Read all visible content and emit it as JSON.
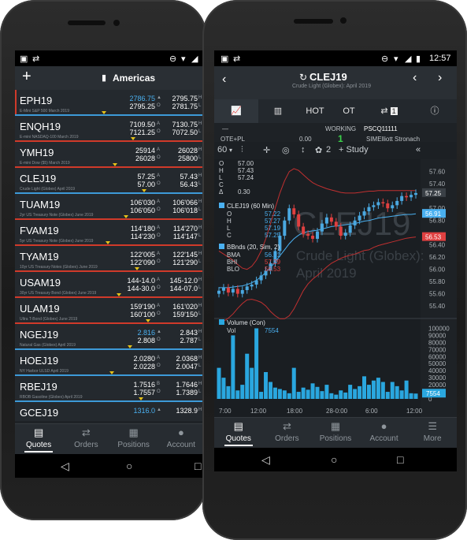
{
  "left": {
    "status_icons": [
      "image-icon",
      "sync-icon",
      "dnd-icon",
      "wifi-icon",
      "signal-icon",
      "battery-icon"
    ],
    "header": {
      "title": "Americas",
      "add": "+"
    },
    "quotes": [
      {
        "symbol": "EPH19",
        "desc": "E-Mini S&P 500 March 2019",
        "bid": "2786.75",
        "ask": "2795.25",
        "bid_dir": "▲",
        "ask_dir": "O",
        "high": "2795.75",
        "low": "2781.75",
        "h": "H",
        "l": "L",
        "bid_color": "#4ab0f0",
        "bar": "blue",
        "flag": true
      },
      {
        "symbol": "ENQH19",
        "desc": "E-mini NASDAQ-100 March 2019",
        "bid": "7109.50",
        "ask": "7121.25",
        "bid_dir": "A",
        "ask_dir": "O",
        "high": "7130.75",
        "low": "7072.50",
        "h": "H",
        "l": "L",
        "bid_color": "#ffffff",
        "bar": "red",
        "flag": false
      },
      {
        "symbol": "YMH19",
        "desc": "E-mini Dow ($5) March 2019",
        "bid": "25914",
        "ask": "26028",
        "bid_dir": "A",
        "ask_dir": "O",
        "high": "26028",
        "low": "25800",
        "h": "H",
        "l": "L",
        "bid_color": "#ffffff",
        "bar": "red",
        "flag": false
      },
      {
        "symbol": "CLEJ19",
        "desc": "Crude Light (Globex) April 2019",
        "bid": "57.25",
        "ask": "57.00",
        "bid_dir": "A",
        "ask_dir": "O",
        "high": "57.43",
        "low": "56.43",
        "h": "H",
        "l": "L",
        "bid_color": "#ffffff",
        "bar": "blue",
        "flag": false
      },
      {
        "symbol": "TUAM19",
        "desc": "2yr US Treasury Note (Globex) June 2019",
        "bid": "106'030",
        "ask": "106'050",
        "bid_dir": "A",
        "ask_dir": "O",
        "high": "106'066",
        "low": "106'018",
        "h": "H",
        "l": "L",
        "bid_color": "#ffffff",
        "bar": "red",
        "flag": false
      },
      {
        "symbol": "FVAM19",
        "desc": "5yr US Treasury Note (Globex) June 2019",
        "bid": "114'180",
        "ask": "114'230",
        "bid_dir": "A",
        "ask_dir": "O",
        "high": "114'270",
        "low": "114'147",
        "h": "H",
        "l": "L",
        "bid_color": "#ffffff",
        "bar": "red",
        "flag": false
      },
      {
        "symbol": "TYAM19",
        "desc": "10yr US Treasury Notes (Globex) June 2019",
        "bid": "122'005",
        "ask": "122'090",
        "bid_dir": "A",
        "ask_dir": "O",
        "high": "122'145",
        "low": "121'290",
        "h": "H",
        "l": "L",
        "bid_color": "#ffffff",
        "bar": "red",
        "flag": false
      },
      {
        "symbol": "USAM19",
        "desc": "30yr US Treasury Bond (Globex) June 2019",
        "bid": "144-14.0",
        "ask": "144-30.0",
        "bid_dir": "A",
        "ask_dir": "O",
        "high": "145-12.0",
        "low": "144-07.0",
        "h": "H",
        "l": "L",
        "bid_color": "#ffffff",
        "bar": "red",
        "flag": false
      },
      {
        "symbol": "ULAM19",
        "desc": "Ultra T-Bond (Globex) June 2019",
        "bid": "159'190",
        "ask": "160'100",
        "bid_dir": "A",
        "ask_dir": "O",
        "high": "161'020",
        "low": "159'150",
        "h": "H",
        "l": "L",
        "bid_color": "#ffffff",
        "bar": "red",
        "flag": false
      },
      {
        "symbol": "NGEJ19",
        "desc": "Natural Gas (Globex) April 2019",
        "bid": "2.816",
        "ask": "2.808",
        "bid_dir": "▲",
        "ask_dir": "O",
        "high": "2.843",
        "low": "2.787",
        "h": "H",
        "l": "L",
        "bid_color": "#4ab0f0",
        "bar": "blue",
        "flag": false
      },
      {
        "symbol": "HOEJ19",
        "desc": "NY Harbor ULSD April 2019",
        "bid": "2.0280",
        "ask": "2.0228",
        "bid_dir": "A",
        "ask_dir": "O",
        "high": "2.0368",
        "low": "2.0047",
        "h": "H",
        "l": "L",
        "bid_color": "#ffffff",
        "bar": "blue",
        "flag": false
      },
      {
        "symbol": "RBEJ19",
        "desc": "RBOB Gasoline (Globex) April 2019",
        "bid": "1.7516",
        "ask": "1.7557",
        "bid_dir": "B",
        "ask_dir": "O",
        "high": "1.7646",
        "low": "1.7389",
        "h": "H",
        "l": "L",
        "bid_color": "#ffffff",
        "bar": "blue",
        "flag": false
      },
      {
        "symbol": "GCEJ19",
        "desc": "",
        "bid": "1316.0",
        "ask": "",
        "bid_dir": "▲",
        "ask_dir": "",
        "high": "1328.9",
        "low": "",
        "h": "H",
        "l": "",
        "bid_color": "#4ab0f0",
        "bar": "blue",
        "flag": false
      }
    ],
    "tabs": [
      {
        "label": "Quotes",
        "icon": "quotes-icon",
        "glyph": "▤"
      },
      {
        "label": "Orders",
        "icon": "orders-icon",
        "glyph": "⇄"
      },
      {
        "label": "Positions",
        "icon": "positions-icon",
        "glyph": "▦"
      },
      {
        "label": "Account",
        "icon": "account-icon",
        "glyph": "●"
      }
    ]
  },
  "right": {
    "status_time": "12:57",
    "header": {
      "symbol": "CLEJ19",
      "subtitle": "Crude Light (Globex): April 2019"
    },
    "toolbar": {
      "hot": "HOT",
      "ot": "OT",
      "orders_count": "1",
      "chart_icon": "chart-icon",
      "bars_icon": "bar-chart-icon",
      "info_icon": "info-icon"
    },
    "order_panel": {
      "minus": "—",
      "working_label": "WORKING",
      "working_value": "1",
      "account": "PSCQ11111",
      "ote_label": "OTE+PL",
      "ote_value": "0.00",
      "account_name": "SIMElliott Stronach"
    },
    "chart_toolbar": {
      "interval": "60",
      "drawing_count": "2",
      "study": "+ Study"
    },
    "chart_data": {
      "type": "line",
      "title": "CLEJ19 (60 Min)",
      "watermark_symbol": "CLEJ19",
      "watermark_name": "Crude Light (Globex):",
      "watermark_date": "April 2019",
      "cursor_ohlc": {
        "O": "57.00",
        "H": "57.43",
        "L": "57.24",
        "C": "0.30"
      },
      "cursor_labels": [
        "O",
        "H",
        "L",
        "C",
        "Δ"
      ],
      "cursor_values": [
        "57.00",
        "57.43",
        "57.24",
        "",
        "0.30"
      ],
      "bar_ohlc": {
        "O": "57.22",
        "H": "57.27",
        "L": "57.19",
        "C": "57.25"
      },
      "bbands_label": "BBnds (20, Sim, 2)",
      "bbands": {
        "BMA": "56.91",
        "BHI": "57.29",
        "BLO": "56.53"
      },
      "volume_label": "Volume (Con)",
      "vol_label": "Vol",
      "vol_value": "7554",
      "price_axis": [
        "57.60",
        "57.40",
        "57.25",
        "57.00",
        "56.91",
        "56.80",
        "56.53",
        "56.40",
        "56.20",
        "56.00",
        "55.80",
        "55.60",
        "55.40"
      ],
      "last_price": "57.25",
      "bma_tag": "56.91",
      "blo_tag": "56.53",
      "volume_axis": [
        "100000",
        "90000",
        "80000",
        "70000",
        "60000",
        "50000",
        "40000",
        "30000",
        "20000",
        "10000",
        "0"
      ],
      "volume_tag": "7554",
      "x_ticks": [
        "7:00",
        "12:00",
        "18:00",
        "28-0:00",
        "6:00",
        "12:00"
      ],
      "close": [
        55.65,
        55.7,
        55.62,
        55.68,
        55.6,
        55.66,
        55.72,
        55.75,
        55.82,
        55.9,
        55.98,
        56.1,
        56.3,
        56.55,
        56.8,
        57.0,
        56.9,
        56.7,
        56.58,
        56.55,
        56.5,
        56.62,
        56.75,
        56.85,
        56.78,
        56.7,
        56.55,
        56.6,
        56.72,
        56.8,
        56.88,
        56.95,
        57.02,
        57.05,
        57.1,
        57.08,
        57.0,
        57.05,
        57.12,
        57.2,
        57.18,
        57.22,
        57.25
      ],
      "bma": [
        55.7,
        55.7,
        55.7,
        55.71,
        55.72,
        55.73,
        55.75,
        55.78,
        55.82,
        55.88,
        55.95,
        56.03,
        56.12,
        56.22,
        56.32,
        56.42,
        56.5,
        56.56,
        56.6,
        56.62,
        56.63,
        56.64,
        56.66,
        56.68,
        56.7,
        56.71,
        56.72,
        56.73,
        56.74,
        56.75,
        56.77,
        56.79,
        56.8,
        56.82,
        56.84,
        56.85,
        56.86,
        56.87,
        56.88,
        56.89,
        56.9,
        56.9,
        56.91
      ],
      "bhi": [
        56.3,
        56.25,
        56.2,
        56.15,
        56.08,
        56.02,
        56.0,
        56.05,
        56.15,
        56.3,
        56.5,
        56.75,
        57.0,
        57.25,
        57.45,
        57.6,
        57.65,
        57.62,
        57.55,
        57.48,
        57.42,
        57.38,
        57.35,
        57.32,
        57.3,
        57.28,
        57.26,
        57.25,
        57.25,
        57.25,
        57.26,
        57.27,
        57.28,
        57.28,
        57.29,
        57.29,
        57.29,
        57.29,
        57.29,
        57.29,
        57.29,
        57.29,
        57.29
      ],
      "blo": [
        55.1,
        55.15,
        55.2,
        55.27,
        55.36,
        55.44,
        55.5,
        55.51,
        55.49,
        55.46,
        55.4,
        55.31,
        55.24,
        55.19,
        55.19,
        55.24,
        55.35,
        55.5,
        55.65,
        55.76,
        55.84,
        55.9,
        55.97,
        56.04,
        56.1,
        56.14,
        56.18,
        56.21,
        56.23,
        56.25,
        56.28,
        56.31,
        56.32,
        56.36,
        56.39,
        56.41,
        56.43,
        56.45,
        56.47,
        56.49,
        56.51,
        56.52,
        56.53
      ],
      "volume": [
        44000,
        30000,
        18000,
        90000,
        12000,
        20000,
        64000,
        44000,
        100000,
        10000,
        38000,
        24000,
        16000,
        14000,
        12000,
        8000,
        44000,
        10000,
        16000,
        13000,
        22000,
        17000,
        11000,
        20000,
        8000,
        6000,
        12000,
        9000,
        20000,
        14000,
        18000,
        32000,
        20000,
        26000,
        30000,
        24000,
        10000,
        24000,
        18000,
        12000,
        26000,
        8000,
        7554
      ],
      "volume_ylim": [
        0,
        105000
      ],
      "price_ylim": [
        55.35,
        57.7
      ]
    },
    "tabs": [
      {
        "label": "Quotes",
        "icon": "quotes-icon",
        "glyph": "▤"
      },
      {
        "label": "Orders",
        "icon": "orders-icon",
        "glyph": "⇄"
      },
      {
        "label": "Positions",
        "icon": "positions-icon",
        "glyph": "▦"
      },
      {
        "label": "Account",
        "icon": "account-icon",
        "glyph": "●"
      },
      {
        "label": "More",
        "icon": "menu-icon",
        "glyph": "☰"
      }
    ],
    "colors": {
      "up": "#4aa8e0",
      "down": "#e04040",
      "band": "#c03030",
      "bma": "#4ab0f0",
      "volume": "#2aa7df",
      "accent": "#4ab0f0",
      "bid_up": "#4ab0f0",
      "bar_red": "#d03a2a",
      "bar_blue": "#3d9ad8"
    }
  }
}
